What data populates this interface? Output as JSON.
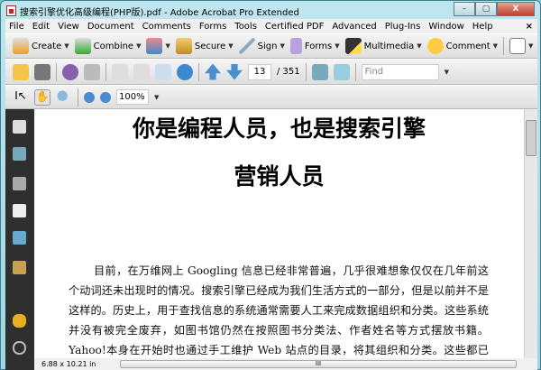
{
  "window": {
    "title": "搜索引擎优化高级编程(PHP版).pdf - Adobe Acrobat Pro Extended",
    "minimize": "–",
    "maximize": "▢",
    "close": "X"
  },
  "menu": [
    "File",
    "Edit",
    "View",
    "Document",
    "Comments",
    "Forms",
    "Tools",
    "Certified PDF",
    "Advanced",
    "Plug-Ins",
    "Window",
    "Help"
  ],
  "menu_close": "×",
  "toolbar": {
    "create": "Create",
    "combine": "Combine",
    "secure": "Secure",
    "sign": "Sign",
    "forms": "Forms",
    "multimedia": "Multimedia",
    "comment": "Comment"
  },
  "nav": {
    "current_page": "13",
    "total_pages": "/ 351",
    "find_placeholder": "Find"
  },
  "zoom": {
    "level": "100%"
  },
  "document": {
    "title_line1": "你是编程人员，也是搜索引擎",
    "title_line2": "营销人员",
    "paragraph": "目前，在万维网上 Googling 信息已经非常普遍，几乎很难想象仅仅在几年前这个动词还未出现时的情况。搜索引擎已经成为我们生活方式的一部分，但是以前并不是这样的。历史上，用于查找信息的系统通常需要人工来完成数据组织和分类。这些系统并没有被完全废弃，如图书馆仍然在按照图书分类法、作者姓名等方式摆放书籍。Yahoo!本身在开始时也通过手工维护 Web 站点的目录，将其组织和分类。这些都已经过去了。"
  },
  "status": {
    "page_size": "6.88 x 10.21 in",
    "scroll_grip": "III"
  }
}
